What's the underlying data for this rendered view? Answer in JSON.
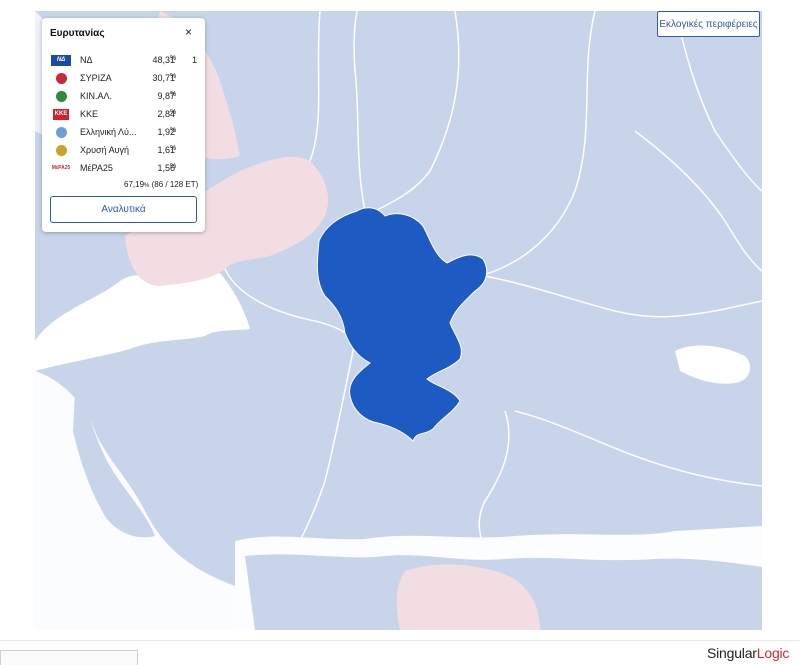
{
  "header": {
    "regions_button_label": "Εκλογικές περιφέρειες"
  },
  "panel": {
    "title": "Ευρυτανίας",
    "close_symbol": "×",
    "parties": [
      {
        "name": "ΝΔ",
        "pct": "48,31",
        "pct_sign": "%",
        "seats": "1",
        "logo_text": "ΝΔ",
        "logo_color": "#1a4aa8"
      },
      {
        "name": "ΣΥΡΙΖΑ",
        "pct": "30,71",
        "pct_sign": "%",
        "seats": "",
        "logo_text": "",
        "logo_color": "#c62a3a"
      },
      {
        "name": "ΚΙΝ.ΑΛ.",
        "pct": "9,87",
        "pct_sign": "%",
        "seats": "",
        "logo_text": "",
        "logo_color": "#2e8b3a"
      },
      {
        "name": "ΚΚΕ",
        "pct": "2,84",
        "pct_sign": "%",
        "seats": "",
        "logo_text": "ΚΚΕ",
        "logo_color": "#d4202a"
      },
      {
        "name": "Ελληνική Λύ...",
        "pct": "1,92",
        "pct_sign": "%",
        "seats": "",
        "logo_text": "",
        "logo_color": "#6aa0d8"
      },
      {
        "name": "Χρυσή Αυγή",
        "pct": "1,61",
        "pct_sign": "%",
        "seats": "",
        "logo_text": "",
        "logo_color": "#c9a227"
      },
      {
        "name": "ΜέΡΑ25",
        "pct": "1,56",
        "pct_sign": "%",
        "seats": "",
        "logo_text": "MέPA25",
        "logo_color": "#c62a3a"
      }
    ],
    "counted_pct": "67,19",
    "counted_pct_sign": "%",
    "counted_detail": "(86 / 128 ΕΤ)",
    "analytics_label": "Αναλυτικά"
  },
  "map": {
    "selected_region": "Ευρυτανίας",
    "colors": {
      "sea": "#c7d4ea",
      "land": "#c7d4ea",
      "selected": "#1d5ac2",
      "other_party": "#f2dde2",
      "coast": "#ffffff",
      "border": "#ffffff"
    }
  },
  "footer": {
    "brand_a": "Singular",
    "brand_b": "Logic"
  }
}
